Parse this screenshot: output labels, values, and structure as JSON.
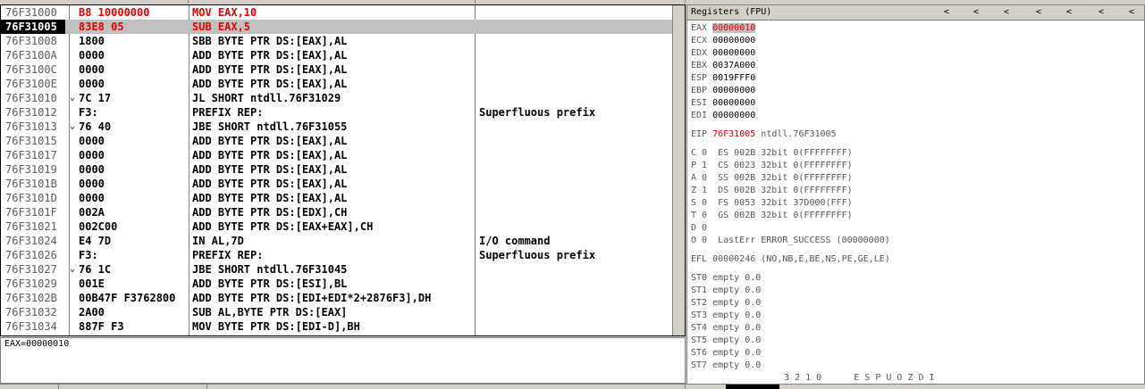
{
  "disasm": {
    "rows": [
      {
        "addr": "76F31000",
        "hex": "B8 10000000",
        "dis": "MOV EAX,10",
        "cmt": "",
        "jmp": "",
        "color": "red"
      },
      {
        "addr": "76F31005",
        "hex": "83E8 05",
        "dis": "SUB EAX,5",
        "cmt": "",
        "jmp": "",
        "color": "red",
        "current": true
      },
      {
        "addr": "76F31008",
        "hex": "1800",
        "dis": "SBB BYTE PTR DS:[EAX],AL",
        "cmt": "",
        "jmp": ""
      },
      {
        "addr": "76F3100A",
        "hex": "0000",
        "dis": "ADD BYTE PTR DS:[EAX],AL",
        "cmt": "",
        "jmp": ""
      },
      {
        "addr": "76F3100C",
        "hex": "0000",
        "dis": "ADD BYTE PTR DS:[EAX],AL",
        "cmt": "",
        "jmp": ""
      },
      {
        "addr": "76F3100E",
        "hex": "0000",
        "dis": "ADD BYTE PTR DS:[EAX],AL",
        "cmt": "",
        "jmp": ""
      },
      {
        "addr": "76F31010",
        "hex": "7C 17",
        "dis": "JL SHORT ntdll.76F31029",
        "cmt": "",
        "jmp": "⌄"
      },
      {
        "addr": "76F31012",
        "hex": "F3:",
        "dis": "PREFIX REP:",
        "cmt": "Superfluous prefix",
        "jmp": ""
      },
      {
        "addr": "76F31013",
        "hex": "76 40",
        "dis": "JBE SHORT ntdll.76F31055",
        "cmt": "",
        "jmp": "⌄"
      },
      {
        "addr": "76F31015",
        "hex": "0000",
        "dis": "ADD BYTE PTR DS:[EAX],AL",
        "cmt": "",
        "jmp": ""
      },
      {
        "addr": "76F31017",
        "hex": "0000",
        "dis": "ADD BYTE PTR DS:[EAX],AL",
        "cmt": "",
        "jmp": ""
      },
      {
        "addr": "76F31019",
        "hex": "0000",
        "dis": "ADD BYTE PTR DS:[EAX],AL",
        "cmt": "",
        "jmp": ""
      },
      {
        "addr": "76F3101B",
        "hex": "0000",
        "dis": "ADD BYTE PTR DS:[EAX],AL",
        "cmt": "",
        "jmp": ""
      },
      {
        "addr": "76F3101D",
        "hex": "0000",
        "dis": "ADD BYTE PTR DS:[EAX],AL",
        "cmt": "",
        "jmp": ""
      },
      {
        "addr": "76F3101F",
        "hex": "002A",
        "dis": "ADD BYTE PTR DS:[EDX],CH",
        "cmt": "",
        "jmp": ""
      },
      {
        "addr": "76F31021",
        "hex": "002C00",
        "dis": "ADD BYTE PTR DS:[EAX+EAX],CH",
        "cmt": "",
        "jmp": ""
      },
      {
        "addr": "76F31024",
        "hex": "E4 7D",
        "dis": "IN AL,7D",
        "cmt": "I/O command",
        "jmp": ""
      },
      {
        "addr": "76F31026",
        "hex": "F3:",
        "dis": "PREFIX REP:",
        "cmt": "Superfluous prefix",
        "jmp": ""
      },
      {
        "addr": "76F31027",
        "hex": "76 1C",
        "dis": "JBE SHORT ntdll.76F31045",
        "cmt": "",
        "jmp": "⌄"
      },
      {
        "addr": "76F31029",
        "hex": "001E",
        "dis": "ADD BYTE PTR DS:[ESI],BL",
        "cmt": "",
        "jmp": ""
      },
      {
        "addr": "76F3102B",
        "hex": "00B47F F3762800",
        "dis": "ADD BYTE PTR DS:[EDI+EDI*2+2876F3],DH",
        "cmt": "",
        "jmp": ""
      },
      {
        "addr": "76F31032",
        "hex": "2A00",
        "dis": "SUB AL,BYTE PTR DS:[EAX]",
        "cmt": "",
        "jmp": ""
      },
      {
        "addr": "76F31034",
        "hex": "887F F3",
        "dis": "MOV BYTE PTR DS:[EDI-D],BH",
        "cmt": "",
        "jmp": ""
      }
    ]
  },
  "info": {
    "text": "EAX=00000010"
  },
  "registers": {
    "title": "Registers (FPU)",
    "arrows": [
      "<",
      "<",
      "<",
      "<",
      "<",
      "<",
      "<"
    ],
    "gp": [
      {
        "name": "EAX",
        "value": "00000010",
        "changed": true
      },
      {
        "name": "ECX",
        "value": "00000000"
      },
      {
        "name": "EDX",
        "value": "00000000"
      },
      {
        "name": "EBX",
        "value": "0037A000"
      },
      {
        "name": "ESP",
        "value": "0019FFF0"
      },
      {
        "name": "EBP",
        "value": "00000000"
      },
      {
        "name": "ESI",
        "value": "00000000"
      },
      {
        "name": "EDI",
        "value": "00000000"
      }
    ],
    "eip": {
      "name": "EIP",
      "value": "76F31005",
      "comment": "ntdll.76F31005"
    },
    "flags": [
      "C 0  ES 002B 32bit 0(FFFFFFFF)",
      "P 1  CS 0023 32bit 0(FFFFFFFF)",
      "A 0  SS 002B 32bit 0(FFFFFFFF)",
      "Z 1  DS 002B 32bit 0(FFFFFFFF)",
      "S 0  FS 0053 32bit 37D000(FFF)",
      "T 0  GS 002B 32bit 0(FFFFFFFF)",
      "D 0",
      "O 0  LastErr ERROR_SUCCESS (00000000)"
    ],
    "efl": "EFL 00000246 (NO,NB,E,BE,NS,PE,GE,LE)",
    "fpu": [
      "ST0 empty 0.0",
      "ST1 empty 0.0",
      "ST2 empty 0.0",
      "ST3 empty 0.0",
      "ST4 empty 0.0",
      "ST5 empty 0.0",
      "ST6 empty 0.0",
      "ST7 empty 0.0"
    ],
    "fpu_footer": "3 2 1 0      E S P U O Z D I"
  }
}
